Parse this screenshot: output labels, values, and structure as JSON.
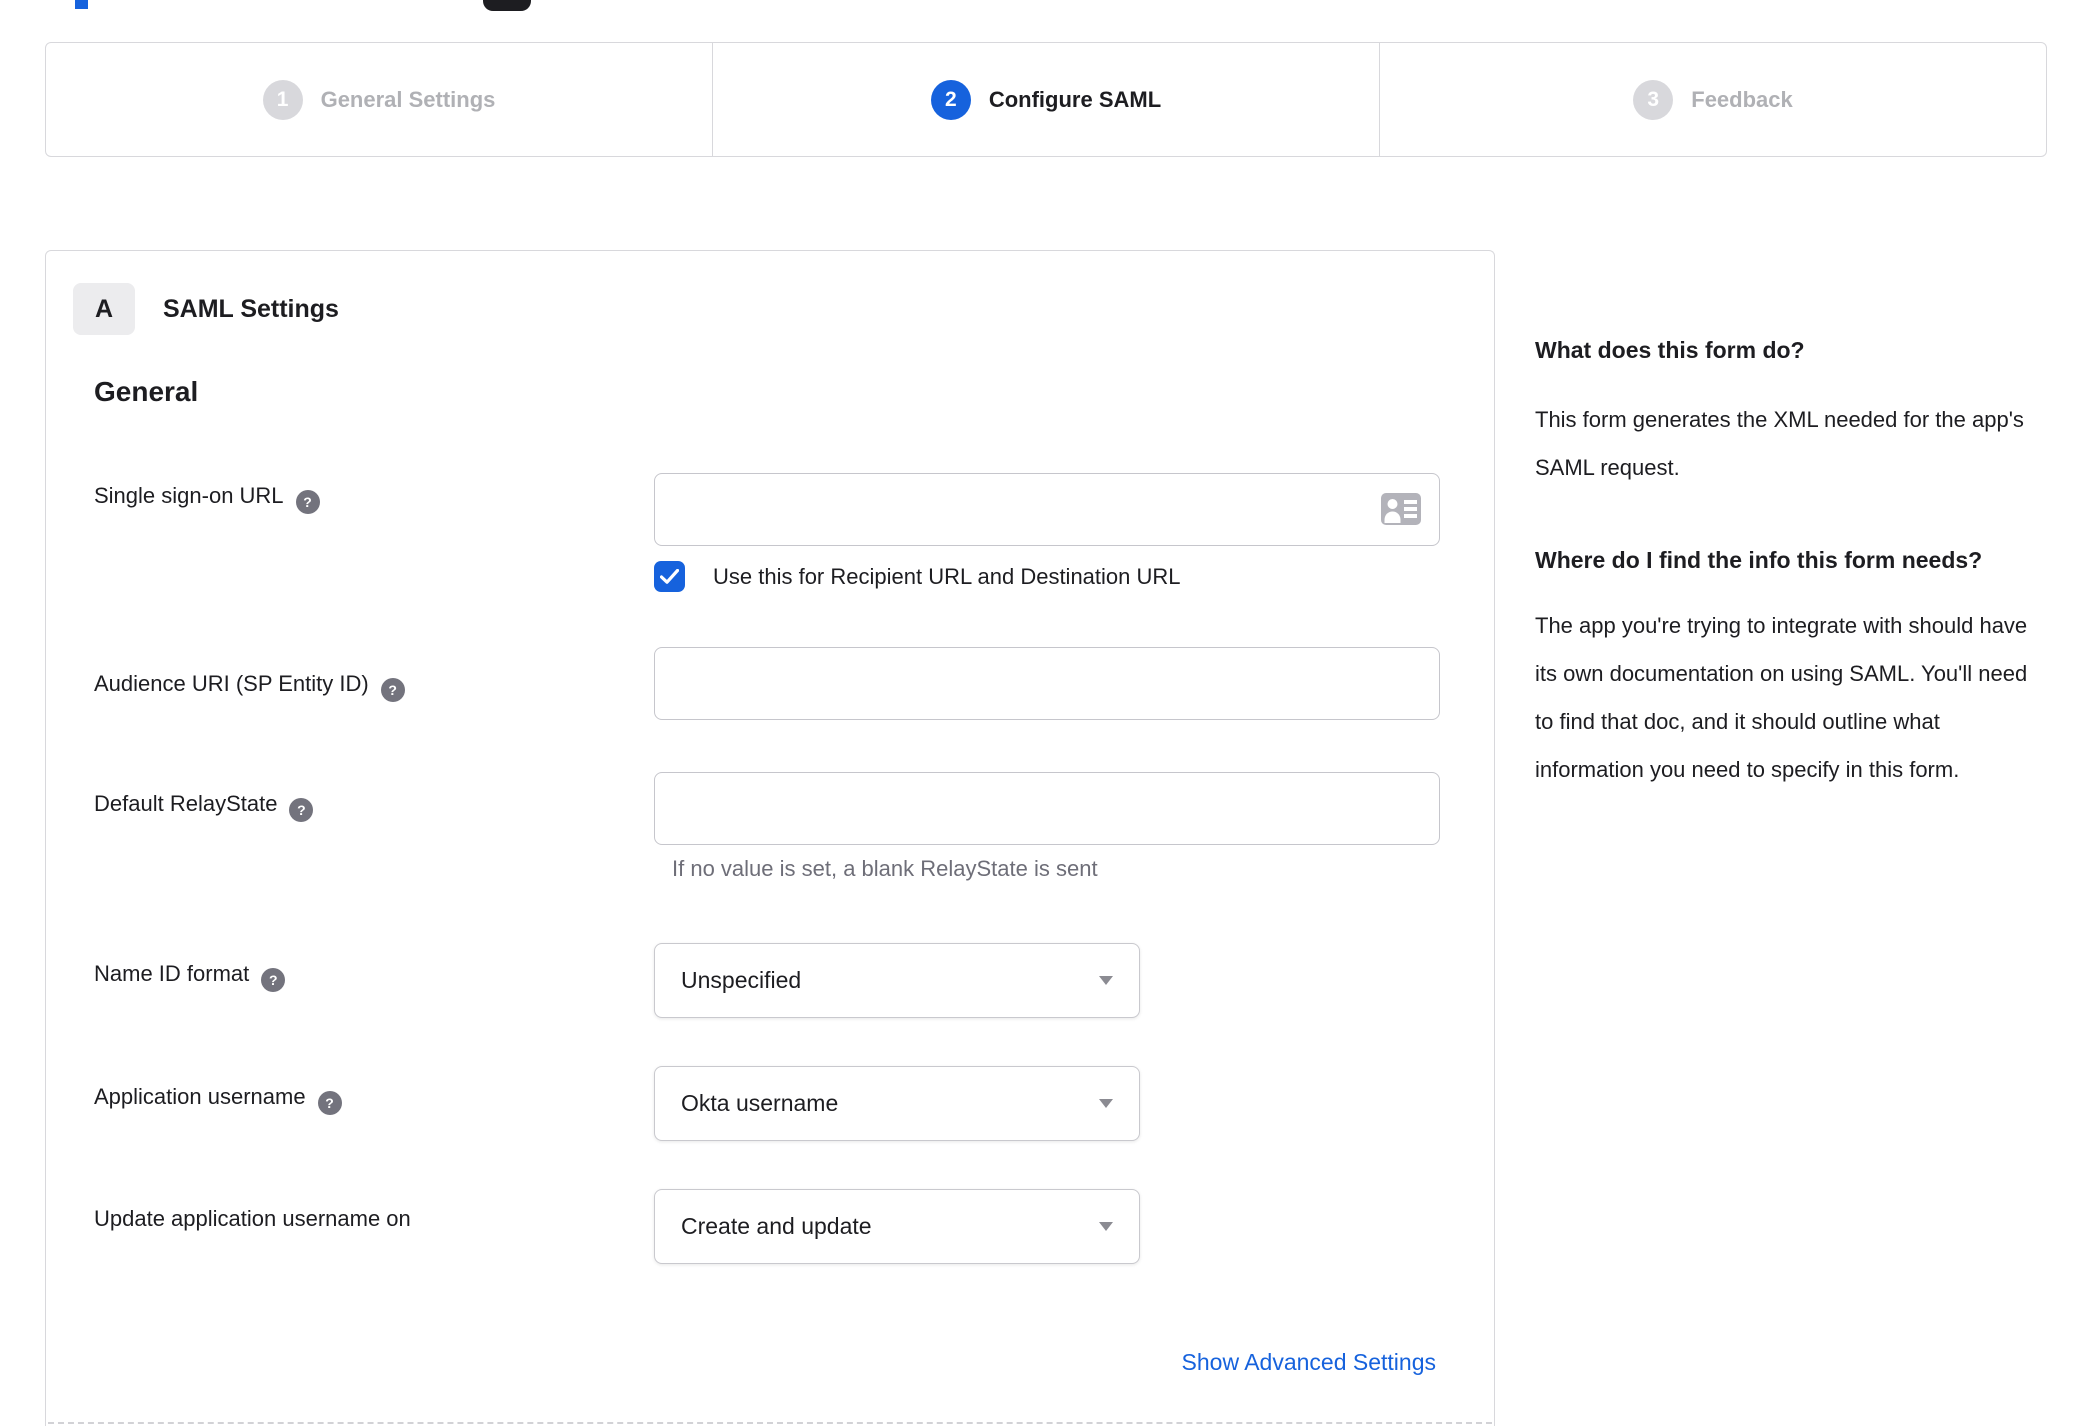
{
  "colors": {
    "accent_blue": "#1662dd",
    "inactive_gray": "#d8d8dc",
    "text_dark": "#1d1d21",
    "hint_gray": "#6e6e78"
  },
  "stepper": {
    "steps": [
      {
        "number": "1",
        "label": "General Settings",
        "state": "inactive"
      },
      {
        "number": "2",
        "label": "Configure SAML",
        "state": "active"
      },
      {
        "number": "3",
        "label": "Feedback",
        "state": "inactive"
      }
    ]
  },
  "panel": {
    "badge": "A",
    "title": "SAML Settings",
    "group_title": "General",
    "fields": {
      "sso": {
        "label": "Single sign-on URL",
        "value": "",
        "checkbox_label": "Use this for Recipient URL and Destination URL",
        "checkbox_checked": true
      },
      "audience": {
        "label": "Audience URI (SP Entity ID)",
        "value": ""
      },
      "relay": {
        "label": "Default RelayState",
        "value": "",
        "hint": "If no value is set, a blank RelayState is sent"
      },
      "name_id": {
        "label": "Name ID format",
        "value": "Unspecified"
      },
      "app_username": {
        "label": "Application username",
        "value": "Okta username"
      },
      "update_username": {
        "label": "Update application username on",
        "value": "Create and update"
      }
    },
    "advanced_link": "Show Advanced Settings"
  },
  "sidebar": {
    "q1": "What does this form do?",
    "a1": "This form generates the XML needed for the app's SAML request.",
    "q2": "Where do I find the info this form needs?",
    "a2": "The app you're trying to integrate with should have its own documentation on using SAML. You'll need to find that doc, and it should outline what information you need to specify in this form."
  },
  "icons": {
    "help": "?"
  }
}
